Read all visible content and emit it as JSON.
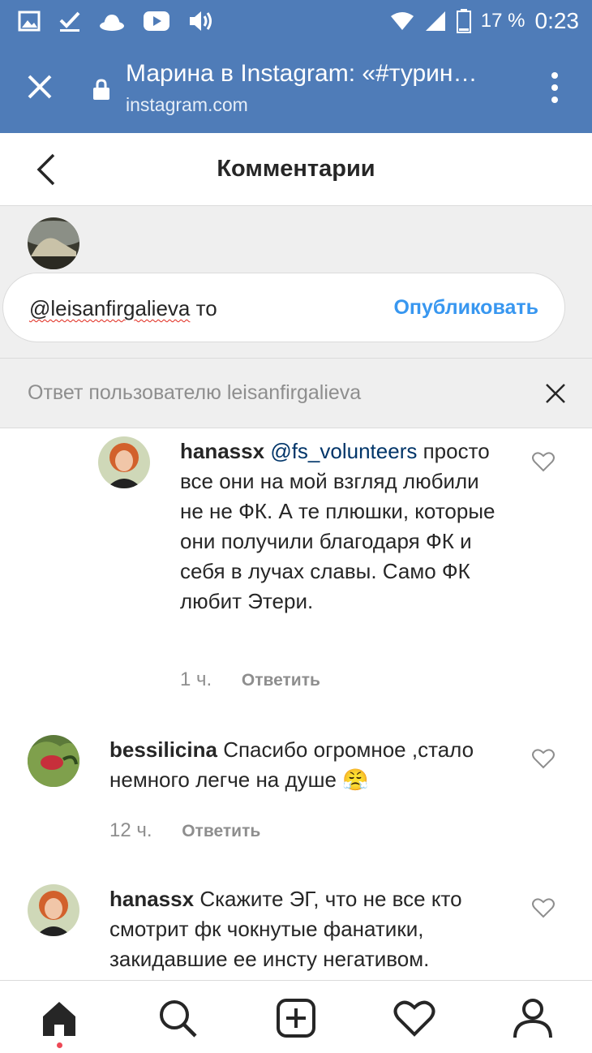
{
  "status_bar": {
    "battery": "17 %",
    "time": "0:23",
    "icons": [
      "image-icon",
      "checkmark-icon",
      "hat-icon",
      "youtube-icon",
      "volume-icon",
      "wifi-icon",
      "signal-icon",
      "battery-icon"
    ]
  },
  "browser": {
    "title": "Марина в Instagram: «#турин…",
    "domain": "instagram.com"
  },
  "header": {
    "title": "Комментарии"
  },
  "composer": {
    "mention": "@leisanfirgalieva",
    "text": " то",
    "publish_label": "Опубликовать"
  },
  "reply_banner": {
    "text": "Ответ пользователю leisanfirgalieva"
  },
  "comments": [
    {
      "username": "hanassx",
      "mention": "@fs_volunteers",
      "text": "просто все они на мой взгляд любили не не ФК. А те плюшки, которые они получили благодаря ФК и себя в лучах славы. Само ФК любит Этери.",
      "time": "1 ч.",
      "reply_label": "Ответить"
    },
    {
      "username": "bessilicina",
      "text": "Спасибо огромное ,стало немного легче на душе 😤",
      "time": "12 ч.",
      "reply_label": "Ответить"
    },
    {
      "username": "hanassx",
      "text": "Скажите ЭГ, что не все кто смотрит фк чокнутые фанатики, закидавшие ее инсту негативом.",
      "time": "",
      "reply_label": ""
    }
  ],
  "nav": [
    "home-icon",
    "search-icon",
    "add-post-icon",
    "activity-heart-icon",
    "profile-icon"
  ],
  "colors": {
    "browser_bar": "#4f7cb8",
    "link": "#3897f0",
    "mention": "#003569",
    "notification_dot": "#ed4956"
  }
}
